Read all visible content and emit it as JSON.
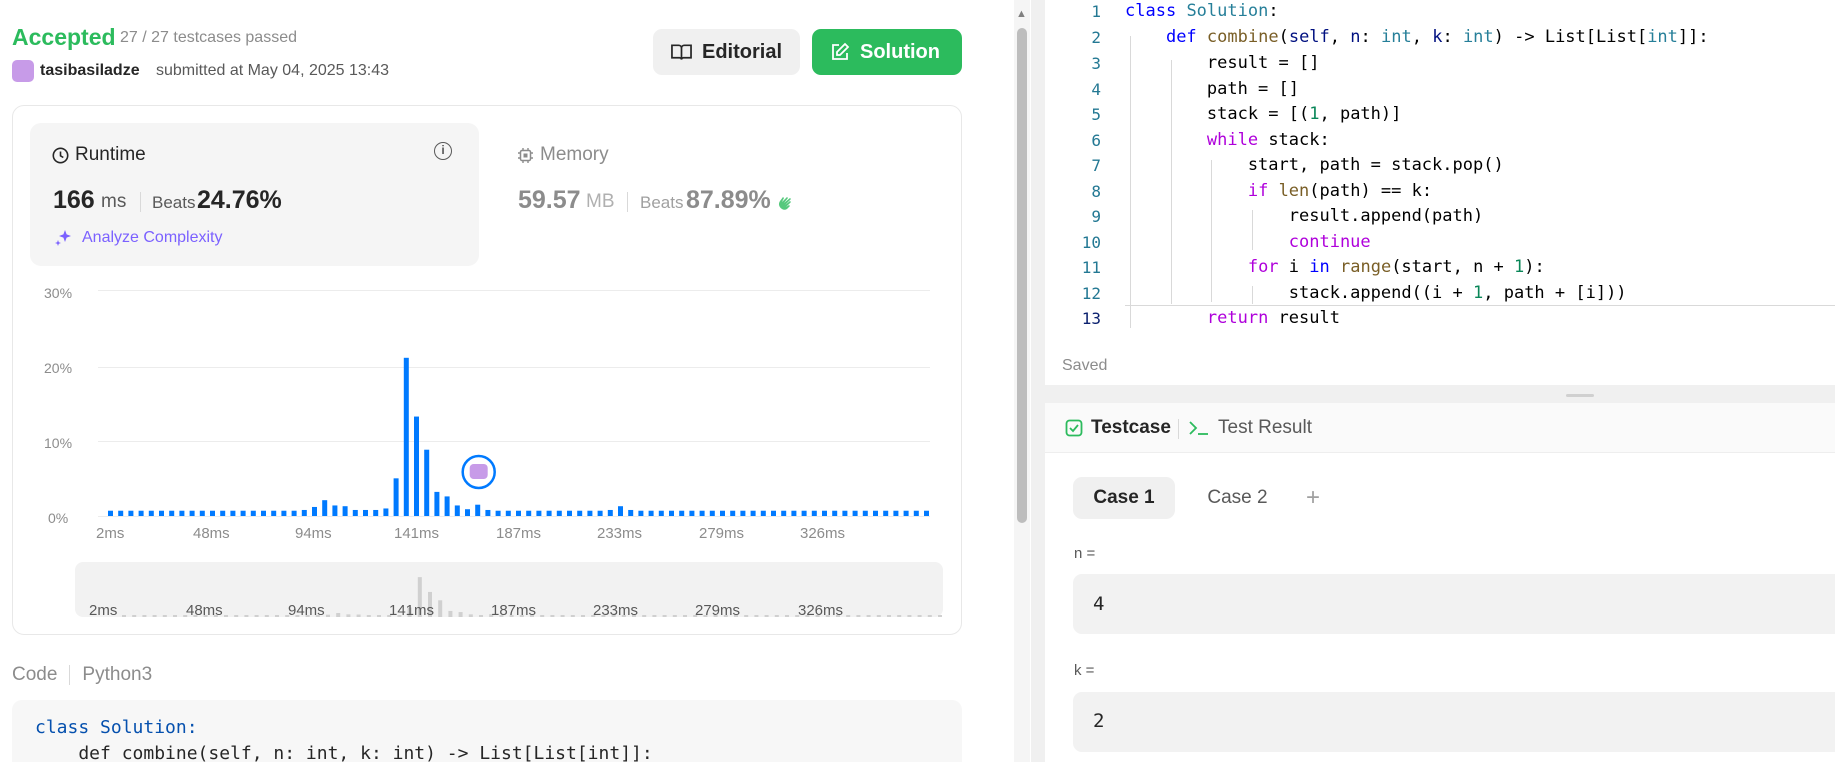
{
  "submission": {
    "status": "Accepted",
    "testcases": "27 / 27 testcases passed",
    "user": "tasibasiladze",
    "submitted": "submitted at May 04, 2025 13:43",
    "editorial_label": "Editorial",
    "solution_label": "Solution"
  },
  "runtime": {
    "label": "Runtime",
    "value": "166",
    "unit": "ms",
    "beats_label": "Beats",
    "beats_value": "24.76%",
    "analyze_label": "Analyze Complexity"
  },
  "memory": {
    "label": "Memory",
    "value": "59.57",
    "unit": "MB",
    "beats_label": "Beats",
    "beats_value": "87.89%"
  },
  "chart_data": {
    "type": "bar",
    "y_ticks": [
      "30%",
      "20%",
      "10%",
      "0%"
    ],
    "ylim": [
      0,
      30
    ],
    "x_ticks": [
      "2ms",
      "48ms",
      "94ms",
      "141ms",
      "187ms",
      "233ms",
      "279ms",
      "326ms"
    ],
    "values": [
      0.7,
      0.7,
      0.7,
      0.7,
      0.7,
      0.7,
      0.7,
      0.7,
      0.7,
      0.7,
      0.7,
      0.7,
      0.7,
      0.7,
      0.7,
      0.7,
      0.7,
      0.7,
      0.7,
      0.8,
      1.2,
      2.1,
      1.4,
      1.3,
      0.8,
      0.8,
      0.8,
      1.0,
      5.0,
      21.0,
      13.2,
      8.8,
      3.2,
      2.6,
      1.4,
      0.9,
      1.5,
      0.8,
      0.7,
      0.7,
      0.7,
      0.7,
      0.7,
      0.7,
      0.7,
      0.7,
      0.7,
      0.7,
      0.7,
      0.8,
      1.3,
      0.8,
      0.7,
      0.7,
      0.7,
      0.7,
      0.7,
      0.7,
      0.7,
      0.7,
      0.7,
      0.7,
      0.7,
      0.7,
      0.7,
      0.7,
      0.7,
      0.7,
      0.7,
      0.7,
      0.7,
      0.7,
      0.7,
      0.7,
      0.7,
      0.7,
      0.7,
      0.7,
      0.7,
      0.7,
      0.7
    ],
    "bar_color": "#007aff",
    "user_marker_index": 36
  },
  "code_section": {
    "label": "Code",
    "language": "Python3",
    "line1": "class Solution:",
    "line2": "    def combine(self, n: int, k: int) -> List[List[int]]:"
  },
  "editor": {
    "saved": "Saved",
    "line_numbers": [
      "1",
      "2",
      "3",
      "4",
      "5",
      "6",
      "7",
      "8",
      "9",
      "10",
      "11",
      "12",
      "13"
    ]
  },
  "testcase_panel": {
    "tab_testcase": "Testcase",
    "tab_result": "Test Result",
    "case1": "Case 1",
    "case2": "Case 2",
    "add": "+",
    "n_label": "n =",
    "n_value": "4",
    "k_label": "k =",
    "k_value": "2"
  },
  "colors": {
    "accepted": "#2cbb5d",
    "accent": "#007aff",
    "analyze": "#7b61ff"
  }
}
